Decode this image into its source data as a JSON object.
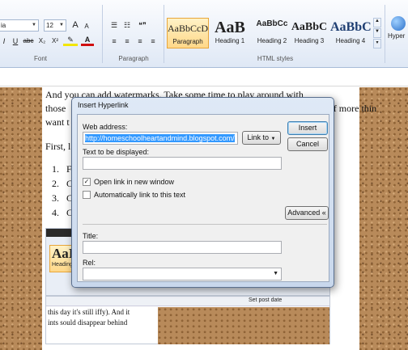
{
  "ribbon": {
    "font_name": "ia",
    "font_size": "12",
    "font_group_label": "Font",
    "paragraph_group_label": "Paragraph",
    "styles_group_label": "HTML styles",
    "hyperlink_label": "Hyper",
    "format_buttons": [
      "I",
      "U",
      "abc",
      "X₂",
      "X²"
    ],
    "quote_glyph": "❝❞",
    "styles": [
      {
        "sample": "AaBbCcD",
        "name": "Paragraph",
        "selected": true
      },
      {
        "sample": "AaB",
        "name": "Heading 1"
      },
      {
        "sample": "AaBbCc",
        "name": "Heading 2"
      },
      {
        "sample": "AaBbC",
        "name": "Heading 3"
      },
      {
        "sample": "AaBbC",
        "name": "Heading 4"
      }
    ],
    "colors": {
      "highlight": "#f2e600",
      "font_color": "#d01010",
      "accent": "#e8a63a"
    }
  },
  "document": {
    "line1": "And you can add watermarks.  Take some time to play around with",
    "line2": "those",
    "line2_hidden": "There's just a couple of more thin",
    "line3": "want t",
    "line4": "First, l",
    "list_numbers": [
      "1.",
      "2.",
      "3.",
      "4."
    ],
    "list_initials": [
      "F",
      "C",
      "C",
      "C"
    ],
    "inner_style_sample": "AaI",
    "inner_style_name": "Heading",
    "inner_status": "Set post date",
    "inner_line1": "this day it's still iffy).  And it",
    "inner_line2": "ints sould disappear behind"
  },
  "dialog": {
    "title": "Insert Hyperlink",
    "web_address_label": "Web address:",
    "web_address_value": "http://homeschoolheartandmind.blogspot.com/",
    "link_to_label": "Link to",
    "insert_label": "Insert",
    "cancel_label": "Cancel",
    "display_text_label": "Text to be displayed:",
    "display_text_value": "",
    "new_window_label": "Open link in new window",
    "new_window_checked": true,
    "auto_link_label": "Automatically link to this text",
    "auto_link_checked": false,
    "advanced_label": "Advanced «",
    "title_label": "Title:",
    "title_value": "",
    "rel_label": "Rel:",
    "rel_value": ""
  }
}
